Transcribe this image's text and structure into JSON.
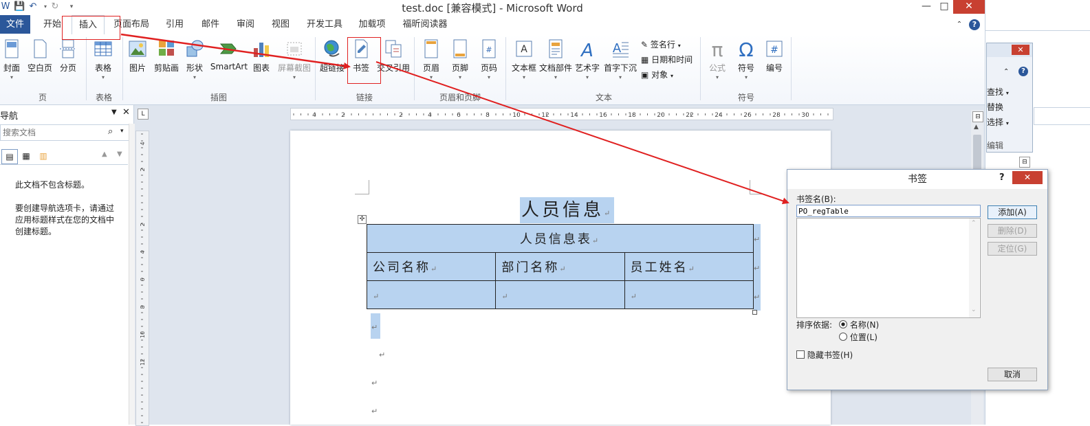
{
  "window": {
    "title": "test.doc [兼容模式] - Microsoft Word",
    "controls": {
      "minimize": "—",
      "maximize": "□",
      "close": "✕"
    },
    "help": "?"
  },
  "tabs": [
    "文件",
    "开始",
    "插入",
    "页面布局",
    "引用",
    "邮件",
    "审阅",
    "视图",
    "开发工具",
    "加载项",
    "福昕阅读器"
  ],
  "ribbon": {
    "groups": {
      "pages": "页",
      "tables": "表格",
      "illustrations": "插图",
      "links": "链接",
      "header_footer": "页眉和页脚",
      "text": "文本",
      "symbols": "符号"
    },
    "buttons": {
      "cover": "封面",
      "blank_page": "空白页",
      "page_break": "分页",
      "table": "表格",
      "picture": "图片",
      "clipart": "剪贴画",
      "shapes": "形状",
      "smartart": "SmartArt",
      "chart": "图表",
      "screenshot": "屏幕截图",
      "hyperlink": "超链接",
      "bookmark": "书签",
      "crossref": "交叉引用",
      "header": "页眉",
      "footer": "页脚",
      "page_number": "页码",
      "textbox": "文本框",
      "quickparts": "文档部件",
      "wordart": "艺术字",
      "dropcap": "首字下沉",
      "signature_line": "签名行",
      "datetime": "日期和时间",
      "object": "对象",
      "equation": "公式",
      "symbol": "符号",
      "number": "编号"
    }
  },
  "nav": {
    "title": "导航",
    "search_placeholder": "搜索文档",
    "empty_line1": "此文档不包含标题。",
    "empty_line2": "要创建导航选项卡，请通过应用标题样式在您的文档中创建标题。"
  },
  "document": {
    "heading": "人员信息",
    "table_title": "人员信息表",
    "columns": [
      "公司名称",
      "部门名称",
      "员工姓名"
    ],
    "para_mark": "↵"
  },
  "ruler": {
    "h_ticks": [
      "4",
      "2",
      "2",
      "4",
      "6",
      "8",
      "10",
      "12",
      "14",
      "16",
      "18",
      "20",
      "22",
      "24",
      "26",
      "28",
      "30"
    ],
    "v_ticks": [
      "4",
      "2",
      "2",
      "4",
      "6",
      "8",
      "10",
      "12"
    ]
  },
  "right_pane": {
    "find": "查找",
    "replace": "替换",
    "select": "选择",
    "edit": "编辑"
  },
  "dialog": {
    "title": "书签",
    "help": "?",
    "close": "✕",
    "name_label": "书签名(B):",
    "name_value": "PO_regTable",
    "add": "添加(A)",
    "delete": "删除(D)",
    "goto": "定位(G)",
    "sort_label": "排序依据:",
    "sort_name": "名称(N)",
    "sort_location": "位置(L)",
    "hidden_label": "隐藏书签(H)",
    "cancel": "取消"
  },
  "colors": {
    "accent": "#2b579a",
    "selection": "#b8d3f0",
    "annotation": "#e02020",
    "close_red": "#c84031"
  }
}
